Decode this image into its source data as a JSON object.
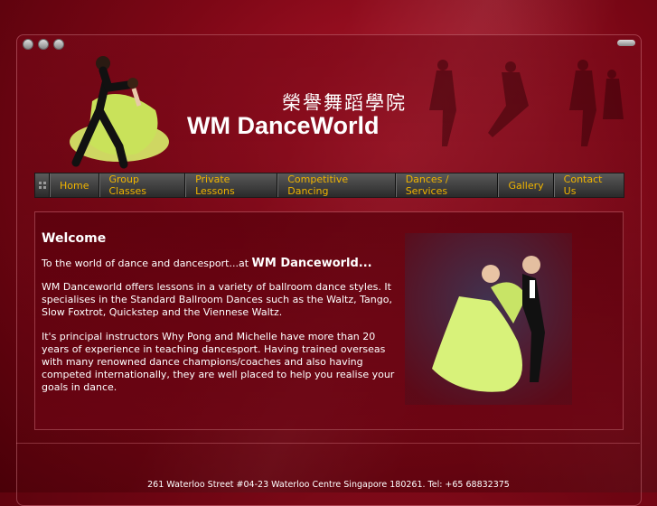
{
  "header": {
    "chinese_name": "榮譽舞蹈學院",
    "brand": "WM DanceWorld"
  },
  "nav": {
    "items": [
      {
        "label": "Home"
      },
      {
        "label": "Group Classes"
      },
      {
        "label": "Private Lessons"
      },
      {
        "label": "Competitive Dancing"
      },
      {
        "label": "Dances / Services"
      },
      {
        "label": "Gallery"
      },
      {
        "label": "Contact Us"
      }
    ]
  },
  "main": {
    "heading": "Welcome",
    "intro_text": "To the world of dance and dancesport...at ",
    "intro_brand": "WM Danceworld...",
    "paragraph1": "WM Danceworld offers lessons in a variety of ballroom dance styles. It specialises in the Standard Ballroom Dances such as the Waltz, Tango, Slow Foxtrot, Quickstep and the Viennese Waltz.",
    "paragraph2": "It's principal instructors Why Pong and Michelle have more than 20 years of experience in teaching dancesport. Having trained overseas with many renowned dance champions/coaches and also having competed internationally, they are well placed to help you realise your goals in dance."
  },
  "footer": {
    "address": "261 Waterloo Street #04-23 Waterloo Centre Singapore 180261. Tel: +65 68832375"
  },
  "colors": {
    "nav_text": "#f0b400",
    "background": "#7d0716"
  }
}
